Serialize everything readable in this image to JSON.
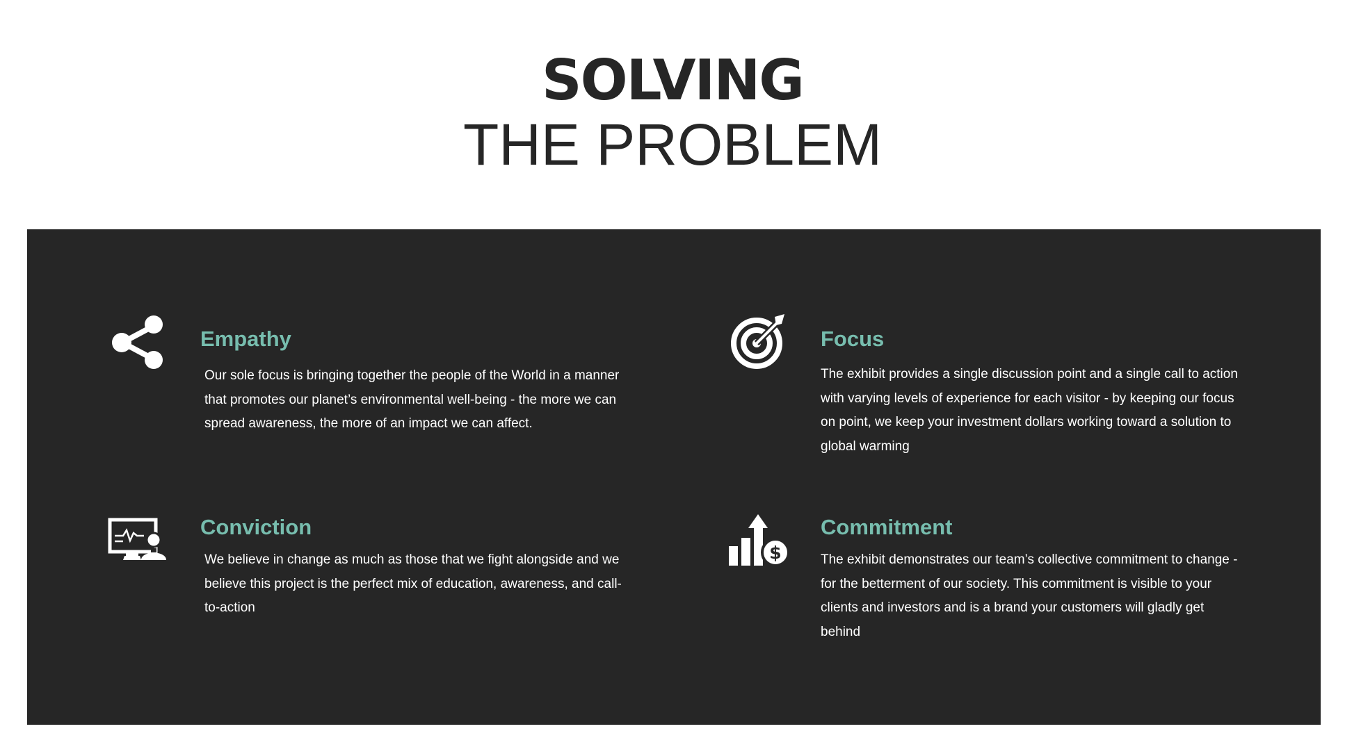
{
  "header": {
    "title_line1": "SOLVING",
    "title_line2": "THE PROBLEM"
  },
  "colors": {
    "panel_background": "#262626",
    "accent": "#77bdae",
    "title": "#262626",
    "body_text": "#ffffff"
  },
  "features": [
    {
      "icon": "share-icon",
      "heading": "Empathy",
      "body": "Our sole focus is bringing together the people of the World in a manner that promotes our planet’s environmental well-being - the more we can spread awareness, the more of an impact we can affect."
    },
    {
      "icon": "target-icon",
      "heading": "Focus",
      "body": "The exhibit provides a single discussion point and a single call to action with varying levels of experience for each visitor - by keeping our focus on point, we keep your investment dollars working toward a solution to global warming"
    },
    {
      "icon": "monitor-presenter-icon",
      "heading": "Conviction",
      "body": "We believe in change as much as those that we fight alongside and we believe this project is the perfect mix of education, awareness, and call-to-action"
    },
    {
      "icon": "growth-chart-dollar-icon",
      "heading": "Commitment",
      "body": "The exhibit demonstrates our team’s collective commitment to change - for the betterment of our society.  This commitment is visible to your clients and investors and is a brand your customers will gladly get behind"
    }
  ]
}
